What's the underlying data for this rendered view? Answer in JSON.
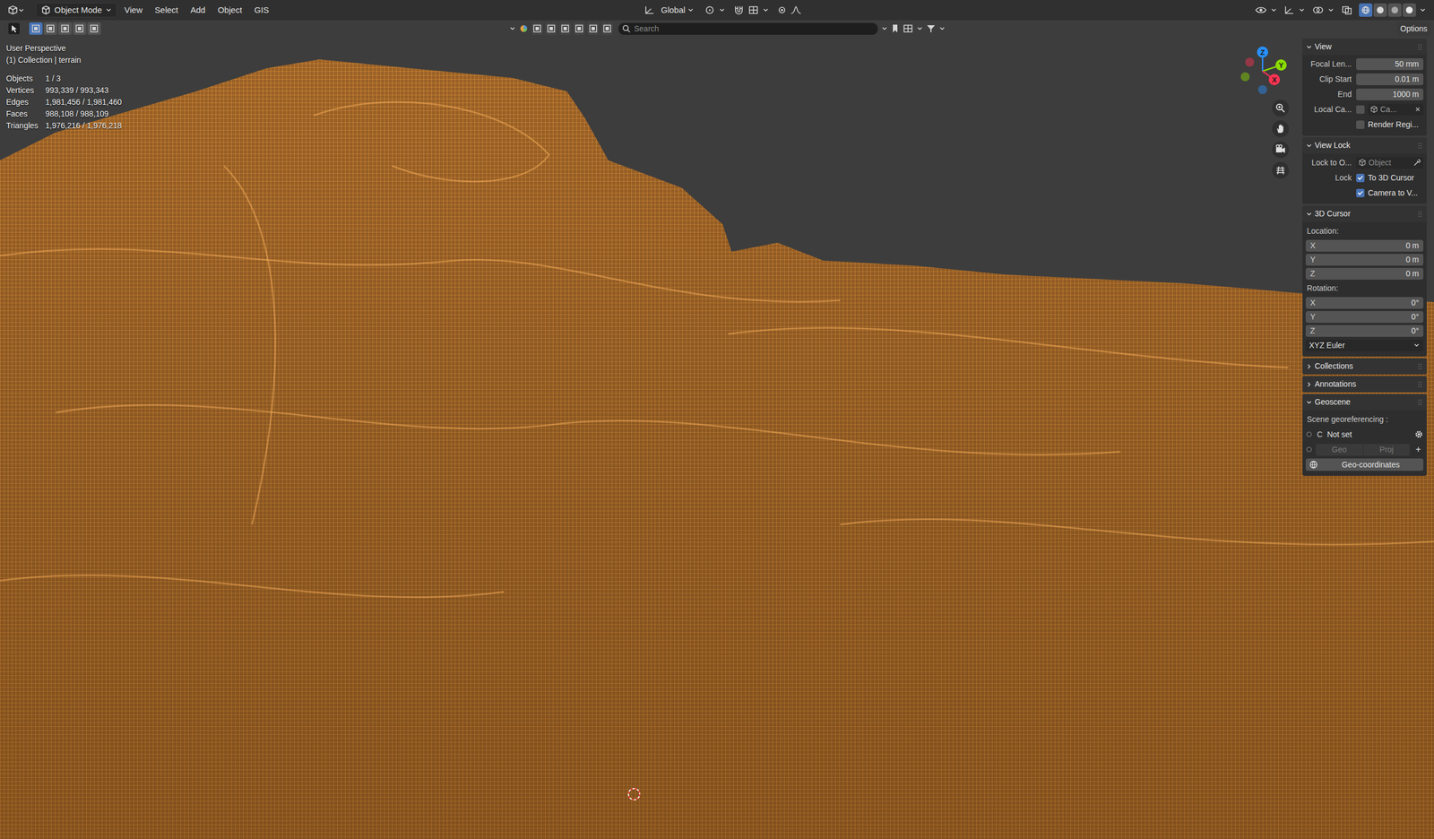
{
  "header": {
    "mode": "Object Mode",
    "menus": [
      "View",
      "Select",
      "Add",
      "Object",
      "GIS"
    ],
    "orientation": "Global",
    "shading": [
      {
        "selected": true
      },
      {
        "selected": false
      },
      {
        "selected": false
      },
      {
        "selected": false
      }
    ]
  },
  "toolbar": {
    "select_modes": [
      {
        "selected": true
      },
      {
        "selected": false
      },
      {
        "selected": false
      },
      {
        "selected": false
      },
      {
        "selected": false
      }
    ],
    "search": {
      "placeholder": "Search"
    },
    "options": "Options"
  },
  "viewport": {
    "view_name": "User Perspective",
    "collection": "(1) Collection | terrain",
    "stats": [
      {
        "label": "Objects",
        "value": "1 / 3"
      },
      {
        "label": "Vertices",
        "value": "993,339 / 993,343"
      },
      {
        "label": "Edges",
        "value": "1,981,456 / 1,981,460"
      },
      {
        "label": "Faces",
        "value": "988,108 / 988,109"
      },
      {
        "label": "Triangles",
        "value": "1,976,216 / 1,976,218"
      }
    ],
    "gizmo": [
      {
        "label": "Z"
      },
      {
        "label": "Y"
      },
      {
        "label": "X"
      }
    ]
  },
  "sidebar": {
    "panels": [
      {
        "title": "View",
        "expanded": true,
        "rows": [
          {
            "kind": "field",
            "label": "Focal Len...",
            "value": "50 mm"
          },
          {
            "kind": "field",
            "label": "Clip Start",
            "value": "0.01 m"
          },
          {
            "kind": "field",
            "label": "End",
            "value": "1000 m"
          },
          {
            "kind": "check_object",
            "label": "Local Ca...",
            "checked": false,
            "value": "Ca..."
          },
          {
            "kind": "check",
            "checked": false,
            "text": "Render Regi..."
          }
        ]
      },
      {
        "title": "View Lock",
        "expanded": true,
        "rows": [
          {
            "kind": "object_field",
            "label": "Lock to O...",
            "value": "Object"
          },
          {
            "kind": "check",
            "label": "Lock",
            "checked": true,
            "text": "To 3D Cursor"
          },
          {
            "kind": "check",
            "checked": true,
            "text": "Camera to V..."
          }
        ]
      },
      {
        "title": "3D Cursor",
        "expanded": true,
        "rows": [
          {
            "kind": "heading",
            "text": "Location:"
          },
          {
            "kind": "axis",
            "label": "X",
            "value": "0 m"
          },
          {
            "kind": "axis",
            "label": "Y",
            "value": "0 m"
          },
          {
            "kind": "axis",
            "label": "Z",
            "value": "0 m"
          },
          {
            "kind": "heading",
            "text": "Rotation:"
          },
          {
            "kind": "axis",
            "label": "X",
            "value": "0°"
          },
          {
            "kind": "axis",
            "label": "Y",
            "value": "0°"
          },
          {
            "kind": "axis",
            "label": "Z",
            "value": "0°"
          },
          {
            "kind": "dropdown",
            "value": "XYZ Euler"
          }
        ]
      },
      {
        "title": "Collections",
        "expanded": false,
        "rows": []
      },
      {
        "title": "Annotations",
        "expanded": false,
        "rows": []
      },
      {
        "title": "Geoscene",
        "expanded": true,
        "rows": [
          {
            "kind": "heading",
            "text": "Scene georeferencing :"
          },
          {
            "kind": "status",
            "text": "C",
            "value": "Not set"
          },
          {
            "kind": "pair",
            "items": [
              {
                "label": "Geo",
                "disabled": true
              },
              {
                "label": "Proj",
                "disabled": true
              }
            ],
            "button": "+"
          },
          {
            "kind": "button",
            "text": "Geo-coordinates"
          }
        ]
      }
    ]
  }
}
